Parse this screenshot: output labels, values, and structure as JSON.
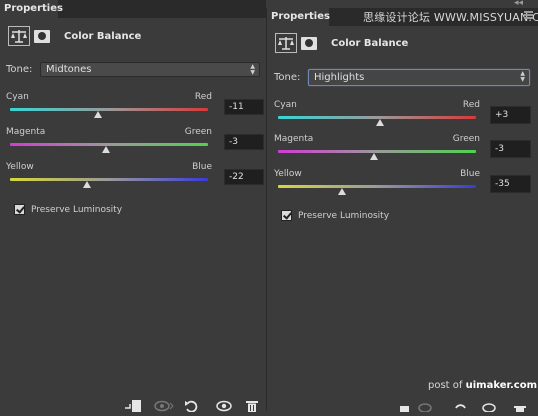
{
  "watermark": "思缘设计论坛 WWW.MISSYUAN.COM",
  "credit_prefix": "post of",
  "credit_site": "uimaker.com",
  "panels": {
    "left": {
      "tab": "Properties",
      "title": "Color Balance",
      "tone_label": "Tone:",
      "tone_value": "Midtones",
      "sliders": [
        {
          "left": "Cyan",
          "right": "Red",
          "value": "-11",
          "level": -11
        },
        {
          "left": "Magenta",
          "right": "Green",
          "value": "-3",
          "level": -3
        },
        {
          "left": "Yellow",
          "right": "Blue",
          "value": "-22",
          "level": -22
        }
      ],
      "preserve_label": "Preserve Luminosity",
      "preserve_checked": true
    },
    "right": {
      "tab": "Properties",
      "title": "Color Balance",
      "tone_label": "Tone:",
      "tone_value": "Highlights",
      "sliders": [
        {
          "left": "Cyan",
          "right": "Red",
          "value": "+3",
          "level": 3
        },
        {
          "left": "Magenta",
          "right": "Green",
          "value": "-3",
          "level": -3
        },
        {
          "left": "Yellow",
          "right": "Blue",
          "value": "-35",
          "level": -35
        }
      ],
      "preserve_label": "Preserve Luminosity",
      "preserve_checked": true
    }
  },
  "colors": {
    "cyan_red": [
      "#37d6d6",
      "#d63a3a"
    ],
    "magenta_green": [
      "#d33bd3",
      "#4fd24f"
    ],
    "yellow_blue": [
      "#d8d83a",
      "#3a3ad8"
    ]
  },
  "bottom_icons": [
    "clip-to-layer-icon",
    "view-previous-icon",
    "reset-icon",
    "visibility-icon",
    "delete-icon"
  ]
}
